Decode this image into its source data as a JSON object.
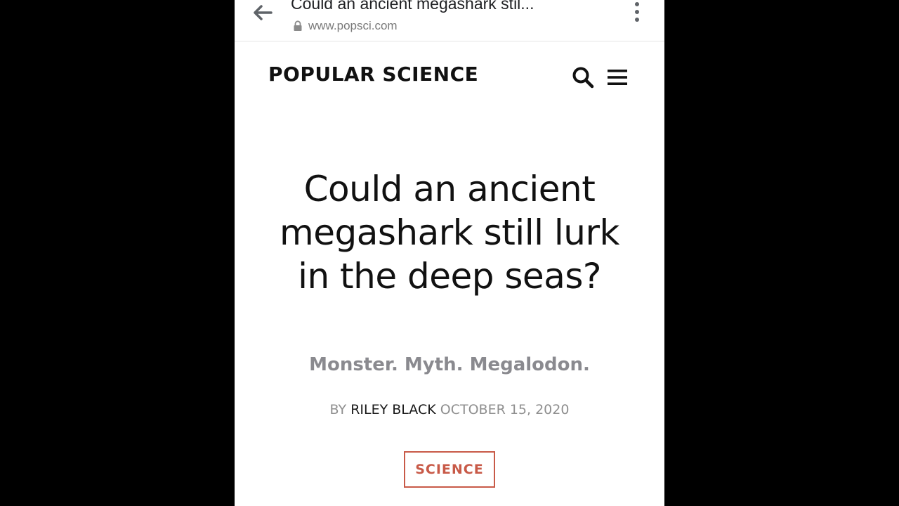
{
  "browser": {
    "tab_title": "Could an ancient megashark stil...",
    "url": "www.popsci.com",
    "icons": {
      "back": "arrow-left-icon",
      "lock": "lock-icon",
      "menu": "more-vertical-icon"
    }
  },
  "site_header": {
    "logo_text": "POPULAR SCIENCE",
    "icons": {
      "search": "search-icon",
      "menu": "hamburger-icon"
    }
  },
  "article": {
    "title": "Could an ancient megashark still lurk in the deep seas?",
    "dek": "Monster. Myth. Megalodon.",
    "byline_prefix": "BY",
    "author": "RILEY BLACK",
    "date": "OCTOBER 15, 2020",
    "category": "SCIENCE"
  },
  "colors": {
    "frame_background": "#000000",
    "page_background": "#ffffff",
    "text_primary": "#111111",
    "text_muted": "#8a8a8f",
    "category_accent": "#c85a48"
  }
}
